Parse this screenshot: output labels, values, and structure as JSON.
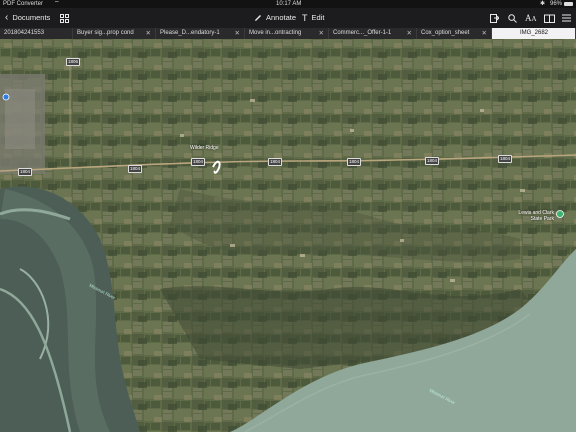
{
  "status_bar": {
    "carrier": "PDF Converter",
    "time": "10:17 AM",
    "battery": "96%"
  },
  "toolbar": {
    "back_label": "Documents",
    "annotate_label": "Annotate",
    "edit_label": "Edit"
  },
  "tabs": [
    {
      "label": "201804241553",
      "active": false,
      "closable": false
    },
    {
      "label": "Buyer sig...prop cond",
      "active": false,
      "closable": true
    },
    {
      "label": "Please_D...endatory-1",
      "active": false,
      "closable": true
    },
    {
      "label": "Move in...ontracting",
      "active": false,
      "closable": true
    },
    {
      "label": "Commerc..._Offer-1-1",
      "active": false,
      "closable": true
    },
    {
      "label": "Cox_option_sheet",
      "active": false,
      "closable": true
    },
    {
      "label": "IMG_2682",
      "active": true,
      "closable": false
    }
  ],
  "map": {
    "labels": {
      "wilder_ridge": "Wilder Ridge",
      "park": "Lewis and Clark State Park",
      "river_1": "Missouri River",
      "river_2": "Missouri River"
    },
    "road_shields": [
      "1804",
      "1804",
      "1804",
      "1804",
      "1804",
      "1804",
      "1804",
      "1806"
    ],
    "colors": {
      "farmland": "#5f6a48",
      "water": "#8fa89a",
      "river_flat": "#4c5e55",
      "road": "#b9a67e"
    }
  }
}
